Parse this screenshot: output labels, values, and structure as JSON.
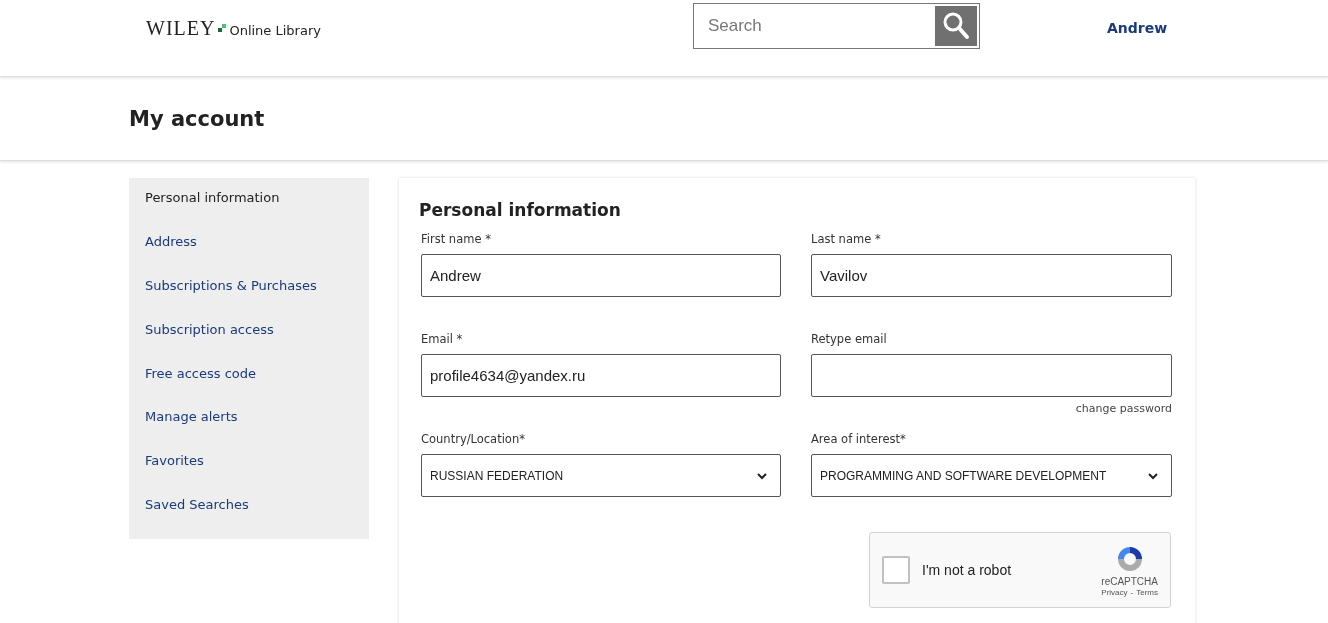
{
  "header": {
    "logo": {
      "brand": "WILEY",
      "product": "Online Library"
    },
    "search": {
      "placeholder": "Search"
    },
    "user": "Andrew"
  },
  "page_title": "My account",
  "sidebar": {
    "items": [
      {
        "label": "Personal information",
        "selected": true
      },
      {
        "label": "Address",
        "selected": false
      },
      {
        "label": "Subscriptions & Purchases",
        "selected": false
      },
      {
        "label": "Subscription access",
        "selected": false
      },
      {
        "label": "Free access code",
        "selected": false
      },
      {
        "label": "Manage alerts",
        "selected": false
      },
      {
        "label": "Favorites",
        "selected": false
      },
      {
        "label": "Saved Searches",
        "selected": false
      }
    ]
  },
  "form": {
    "title": "Personal information",
    "fields": [
      {
        "kind": "input",
        "label": "First name *",
        "value": "Andrew"
      },
      {
        "kind": "input",
        "label": "Last name *",
        "value": "Vavilov"
      },
      {
        "kind": "input",
        "label": "Email *",
        "value": "profile4634@yandex.ru"
      },
      {
        "kind": "input",
        "label": "Retype email",
        "link": "change password"
      },
      {
        "kind": "select",
        "label": "Country/Location*",
        "value": "RUSSIAN FEDERATION"
      },
      {
        "kind": "select",
        "label": "Area of interest*",
        "value": "PROGRAMMING AND SOFTWARE DEVELOPMENT"
      }
    ],
    "captcha": {
      "label": "I'm not a robot",
      "checked": false,
      "brand": "reCAPTCHA",
      "privacy": "Privacy",
      "separator": "-",
      "terms": "Terms"
    }
  }
}
